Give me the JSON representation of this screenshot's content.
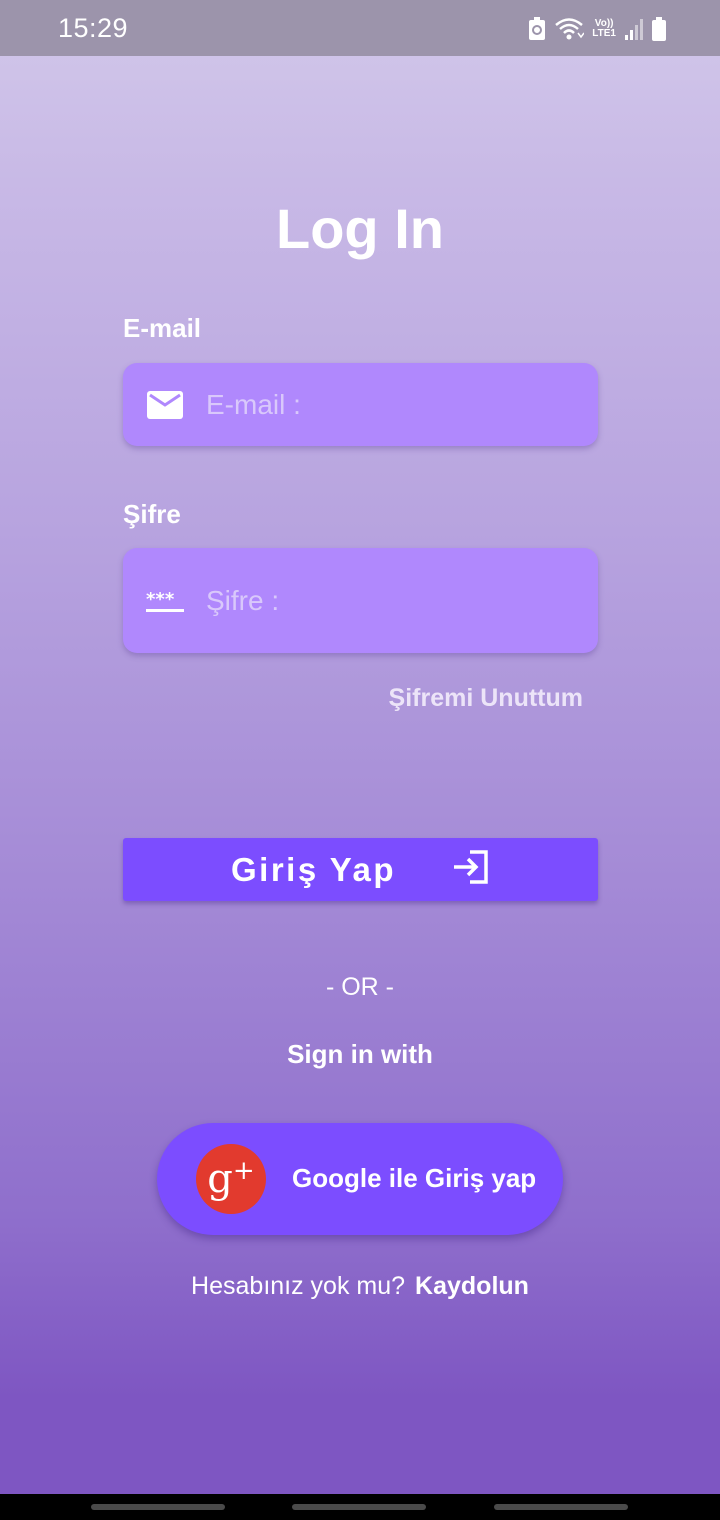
{
  "status_bar": {
    "time": "15:29",
    "icons": [
      "battery-saver-icon",
      "wifi-icon",
      "volte-icon",
      "signal-icon",
      "battery-icon"
    ],
    "volte_label": "Vo))",
    "lte_label": "LTE1"
  },
  "login": {
    "title": "Log In",
    "email_label": "E-mail",
    "email_placeholder": "E-mail :",
    "password_label": "Şifre",
    "password_placeholder": "Şifre :",
    "forgot_password": "Şifremi Unuttum",
    "submit_label": "Giriş Yap",
    "or_divider": "- OR -",
    "sign_in_with": "Sign in with",
    "google_button_label": "Google ile Giriş yap",
    "google_icon_text": "g",
    "google_icon_plus": "+",
    "no_account_text": "Hesabınız yok mu?",
    "register_link": "Kaydolun"
  },
  "colors": {
    "primary": "#7c4dff",
    "input_background": "#b088fd",
    "google_red": "#e23a2e",
    "gradient_top": "#d2c8ea",
    "gradient_bottom": "#7e56c2"
  }
}
